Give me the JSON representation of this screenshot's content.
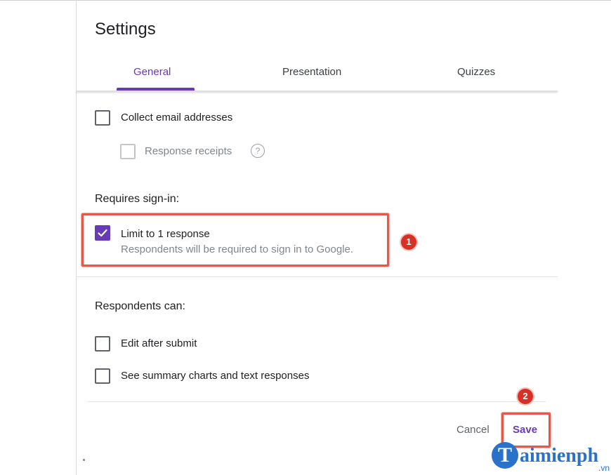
{
  "dialog": {
    "title": "Settings",
    "tabs": [
      {
        "label": "General",
        "active": true
      },
      {
        "label": "Presentation",
        "active": false
      },
      {
        "label": "Quizzes",
        "active": false
      }
    ]
  },
  "options": {
    "collect_email": {
      "label": "Collect email addresses",
      "checked": false
    },
    "response_receipts": {
      "label": "Response receipts",
      "checked": false,
      "disabled": true
    }
  },
  "requires_signin": {
    "title": "Requires sign-in:",
    "limit_response": {
      "label": "Limit to 1 response",
      "description": "Respondents will be required to sign in to Google.",
      "checked": true
    }
  },
  "respondents_can": {
    "title": "Respondents can:",
    "items": [
      {
        "label": "Edit after submit",
        "checked": false
      },
      {
        "label": "See summary charts and text responses",
        "checked": false
      }
    ]
  },
  "actions": {
    "cancel_label": "Cancel",
    "save_label": "Save"
  },
  "annotations": {
    "marker1": "1",
    "marker2": "2"
  },
  "watermark": {
    "brand_initial": "T",
    "brand_rest": "aimienph",
    "tld": ".vn"
  },
  "colors": {
    "accent": "#673ab7",
    "highlight": "#e8584a",
    "marker": "#d93025",
    "watermark": "#2a72c9"
  }
}
